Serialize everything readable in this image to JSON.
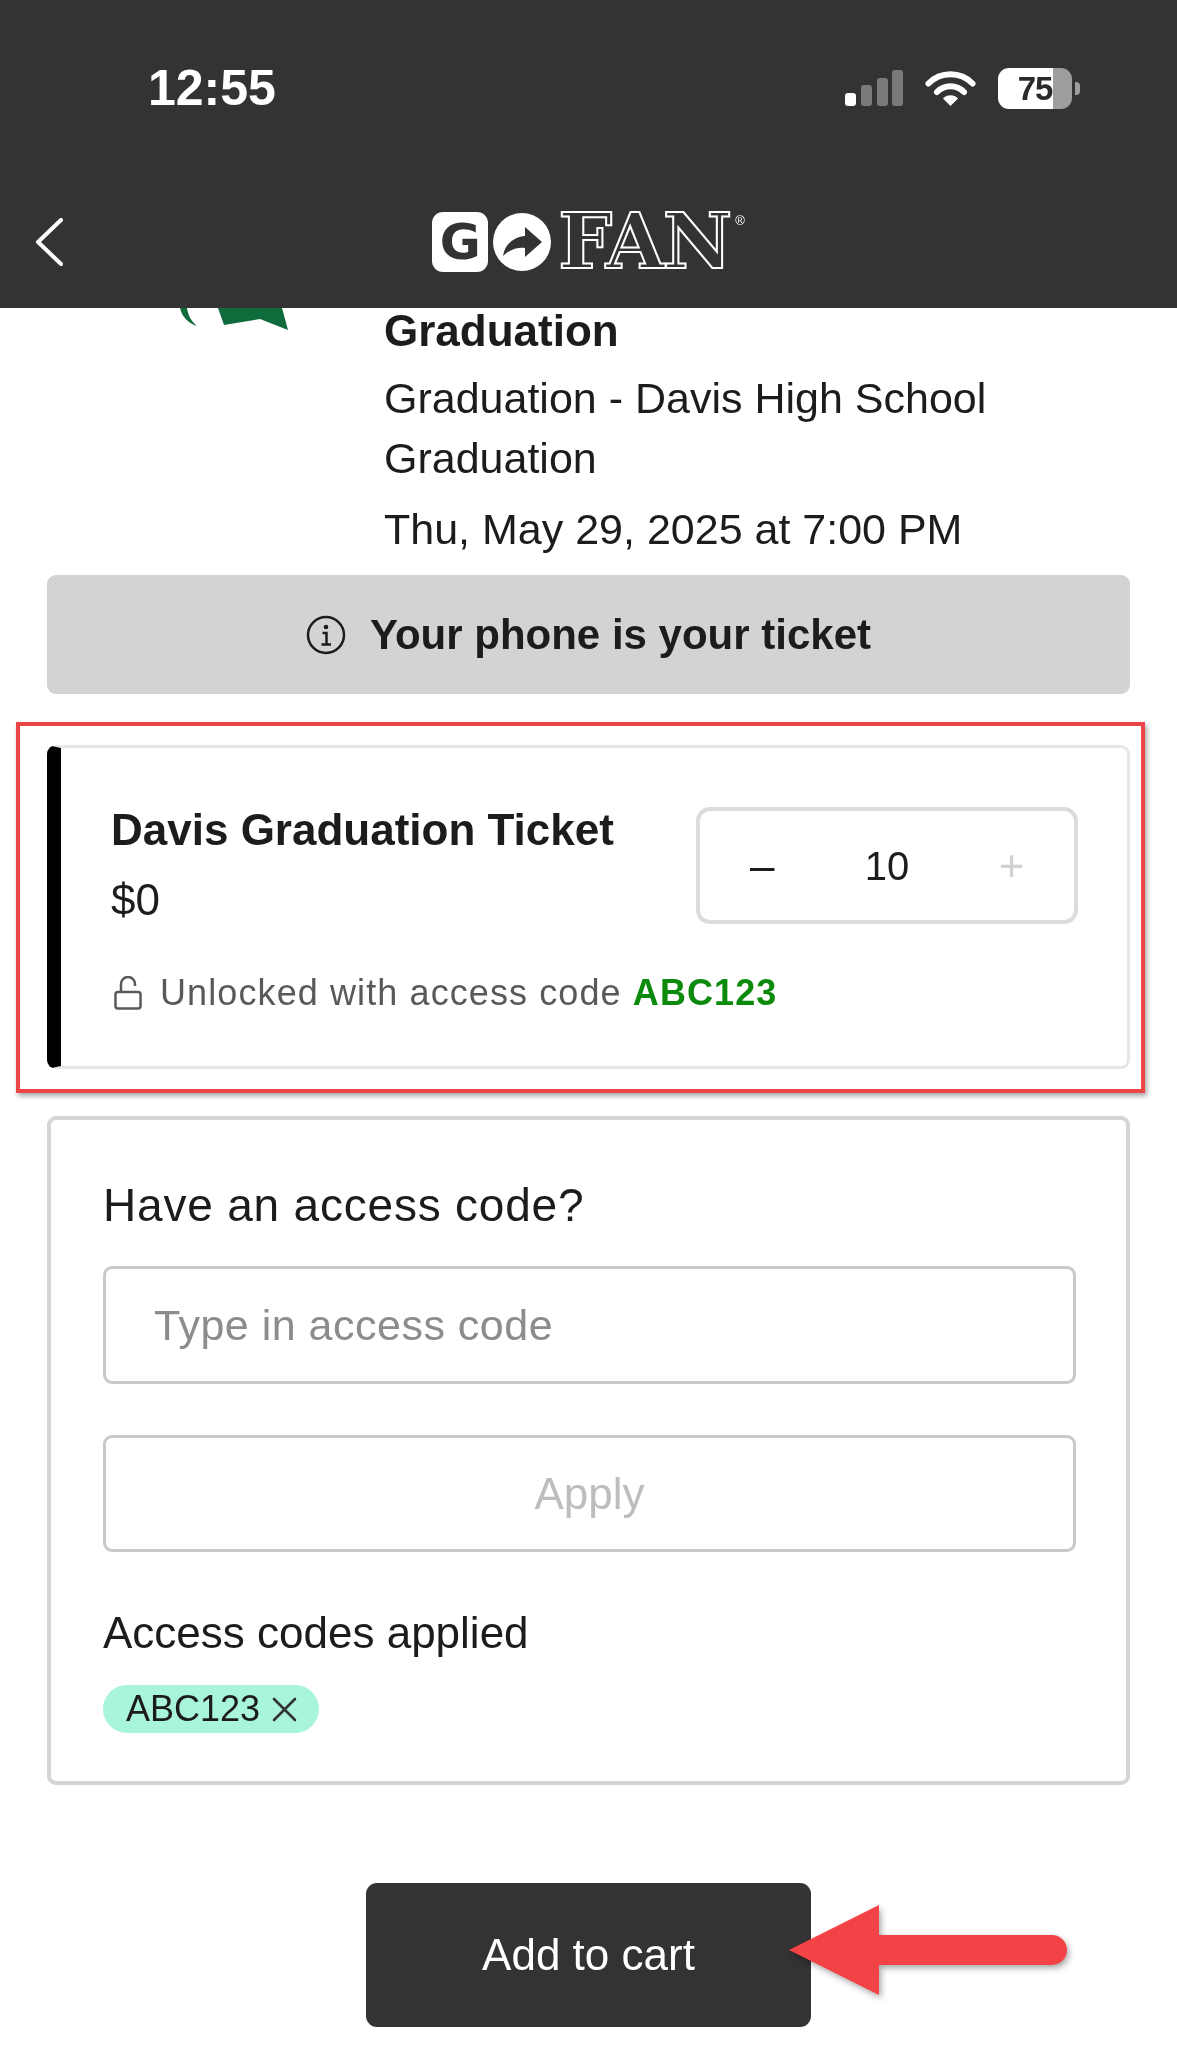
{
  "status_bar": {
    "time": "12:55",
    "battery": "75"
  },
  "nav_bar": {
    "logo": {
      "letters": [
        "G",
        "FAN"
      ],
      "mark": "®"
    }
  },
  "event": {
    "title": "Graduation",
    "subtitle": "Graduation - Davis High School Graduation",
    "date": "Thu, May 29, 2025 at 7:00 PM"
  },
  "notice": {
    "text": "Your phone is your ticket"
  },
  "ticket": {
    "highlighted": true,
    "name": "Davis Graduation Ticket",
    "price": "$0",
    "quantity": {
      "decrement": "–",
      "decrement_disabled": false,
      "value": "10",
      "increment": "+",
      "increment_disabled": true
    },
    "unlock_note": "Unlocked with access code **ABC123**"
  },
  "access_code": {
    "heading": "Have an access code?",
    "input": {
      "placeholder": "Type in access code"
    },
    "apply_button": {
      "label": "Apply",
      "disabled": true
    },
    "applied_label": "Access codes applied",
    "applied_codes": [
      {
        "code": "ABC123"
      }
    ]
  },
  "cart_button": {
    "label": "Add to cart",
    "arrow_annotation": true
  }
}
